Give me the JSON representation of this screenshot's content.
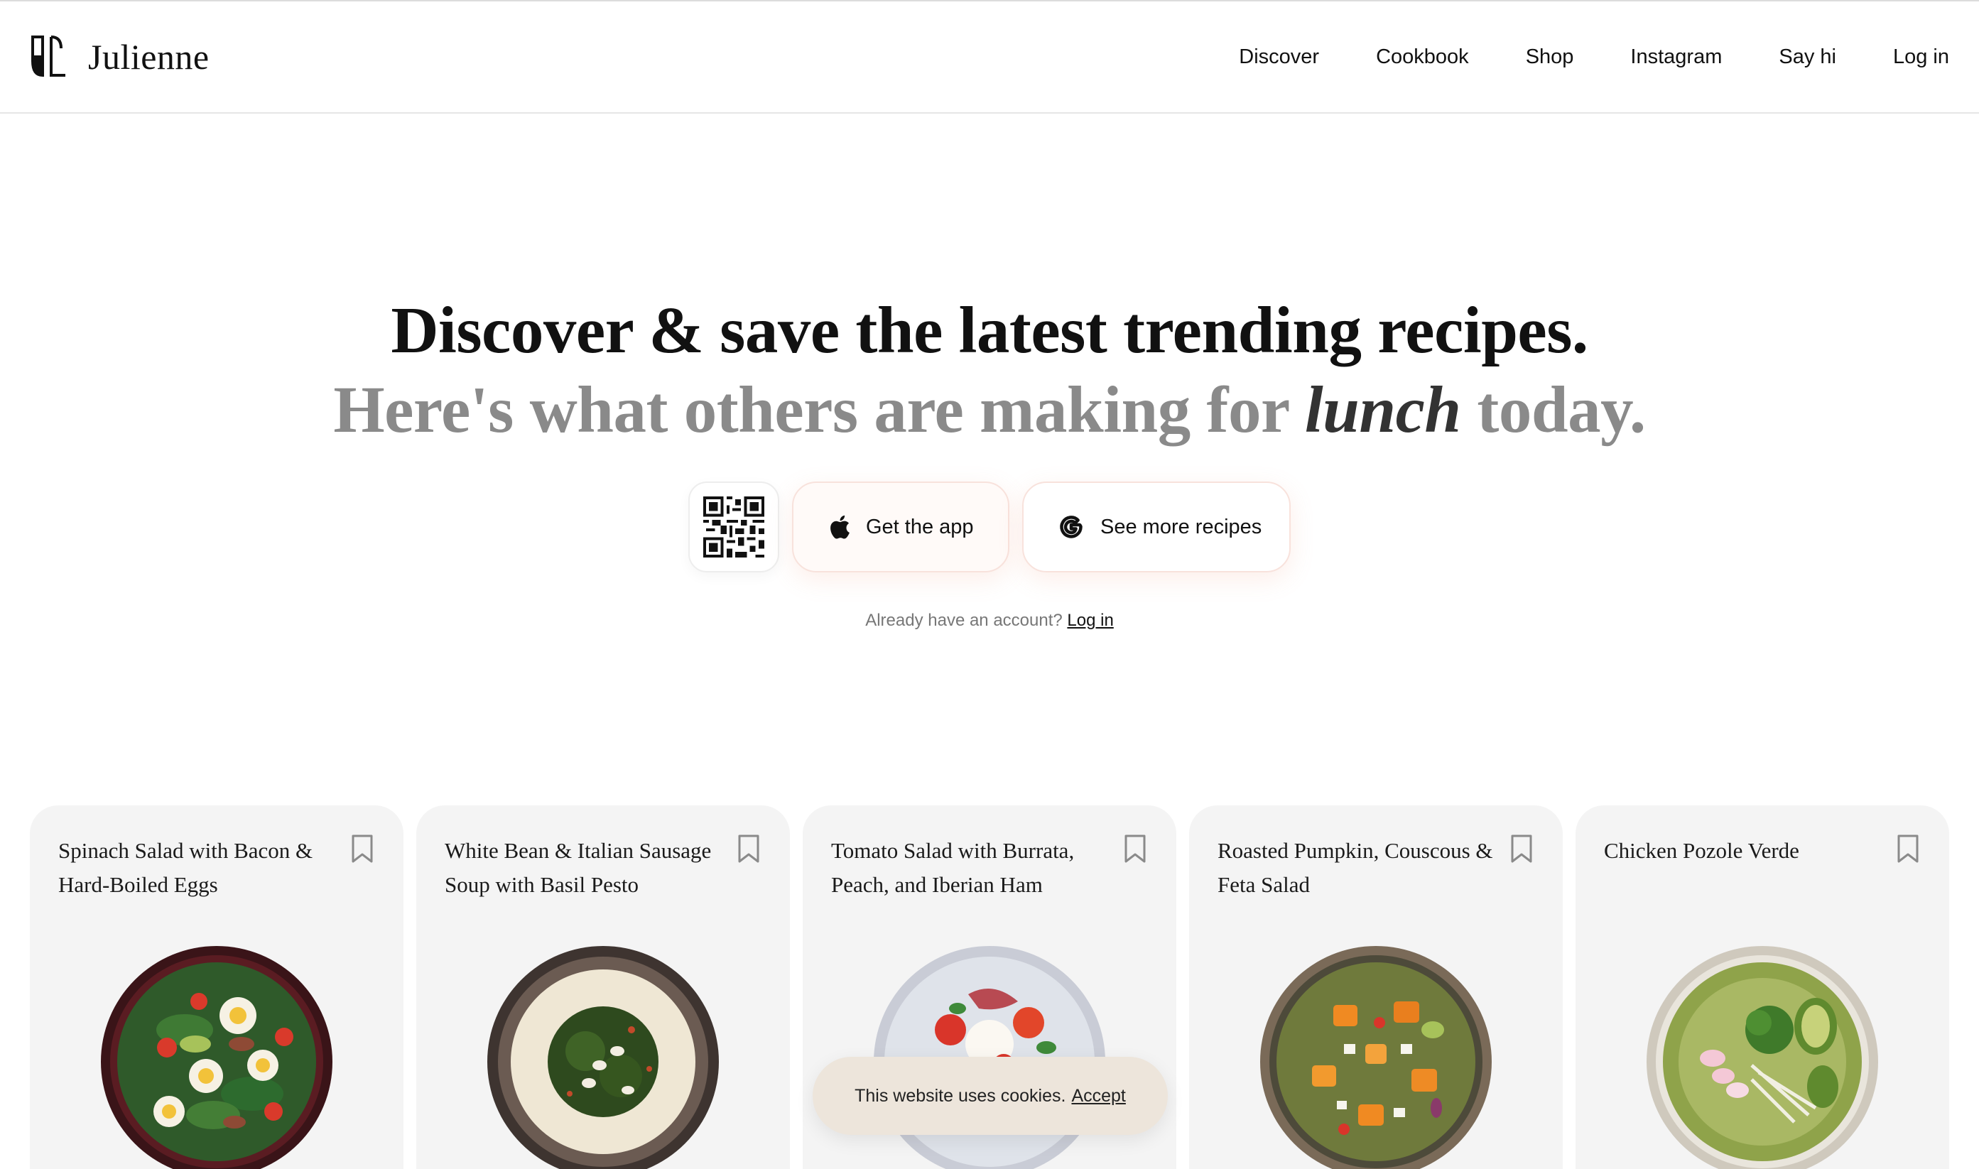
{
  "header": {
    "brand": "Julienne",
    "nav": [
      "Discover",
      "Cookbook",
      "Shop",
      "Instagram",
      "Say hi",
      "Log in"
    ]
  },
  "hero": {
    "line1": "Discover & save the latest trending recipes.",
    "line2_prefix": "Here's what others are making for",
    "line2_meal": "lunch",
    "line2_suffix": "today.",
    "app_button": "Get the app",
    "more_button": "See more recipes",
    "account_prompt": "Already have an account?",
    "login_link": "Log in"
  },
  "icons": {
    "qr": "qr-code-icon",
    "apple": "apple-icon",
    "google": "google-g-icon",
    "bookmark": "bookmark-icon"
  },
  "cards": [
    {
      "title": "Spinach Salad with Bacon & Hard-Boiled Eggs"
    },
    {
      "title": "White Bean & Italian Sausage Soup with Basil Pesto"
    },
    {
      "title": "Tomato Salad with Burrata, Peach, and Iberian Ham"
    },
    {
      "title": "Roasted Pumpkin, Couscous & Feta Salad"
    },
    {
      "title": "Chicken Pozole Verde"
    }
  ],
  "cookie": {
    "message": "This website uses cookies.",
    "accept": "Accept"
  },
  "colors": {
    "card_bg": "#f4f4f4",
    "muted_title": "#8a8a8a",
    "cookie_bg": "#ede5db",
    "pill_border": "#f8e2dc"
  }
}
